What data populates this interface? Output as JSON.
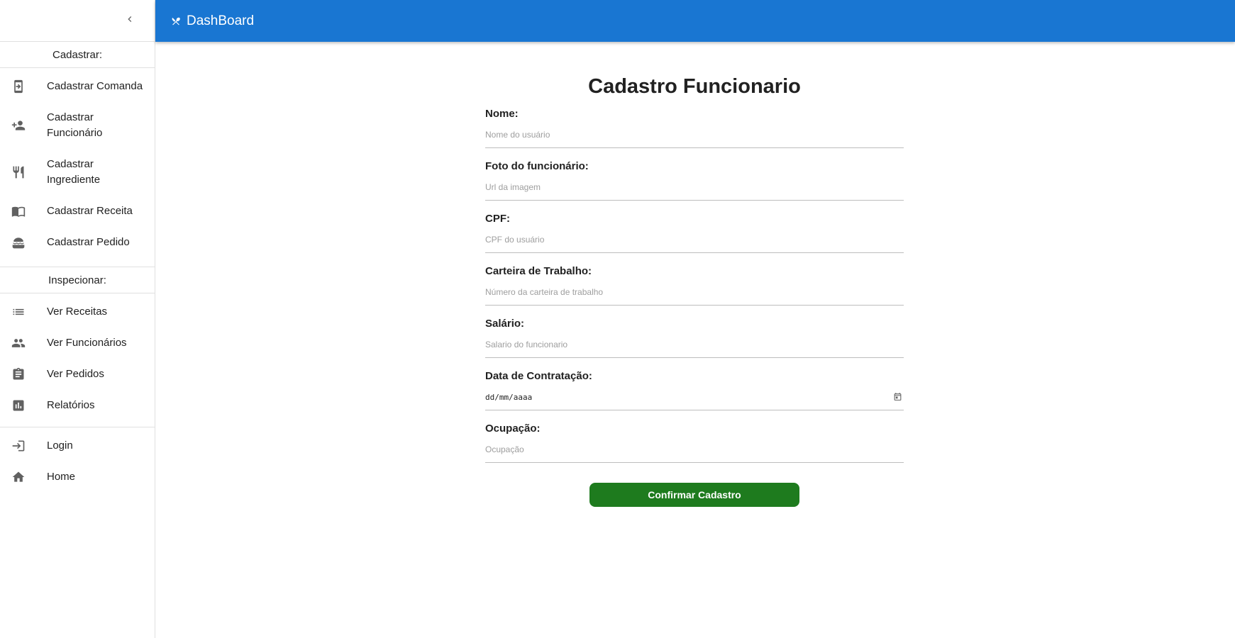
{
  "appbar": {
    "title": "DashBoard"
  },
  "sidebar": {
    "section_register": "Cadastrar:",
    "register_items": [
      {
        "label": "Cadastrar Comanda",
        "icon": "tablet-login-icon"
      },
      {
        "label": "Cadastrar Funcionário",
        "icon": "person-add-icon"
      },
      {
        "label": "Cadastrar Ingrediente",
        "icon": "restaurant-icon"
      },
      {
        "label": "Cadastrar Receita",
        "icon": "menu-book-icon"
      },
      {
        "label": "Cadastrar Pedido",
        "icon": "lunch-dining-icon"
      }
    ],
    "section_inspect": "Inspecionar:",
    "inspect_items": [
      {
        "label": "Ver Receitas",
        "icon": "list-icon"
      },
      {
        "label": "Ver Funcionários",
        "icon": "people-icon"
      },
      {
        "label": "Ver Pedidos",
        "icon": "assignment-icon"
      },
      {
        "label": "Relatórios",
        "icon": "bar-chart-icon"
      }
    ],
    "bottom_items": [
      {
        "label": "Login",
        "icon": "login-icon"
      },
      {
        "label": "Home",
        "icon": "home-icon"
      }
    ]
  },
  "form": {
    "title": "Cadastro Funcionario",
    "fields": [
      {
        "label": "Nome:",
        "placeholder": "Nome do usuário"
      },
      {
        "label": "Foto do funcionário:",
        "placeholder": "Url da imagem"
      },
      {
        "label": "CPF:",
        "placeholder": "CPF do usuário"
      },
      {
        "label": "Carteira de Trabalho:",
        "placeholder": "Número da carteira de trabalho"
      },
      {
        "label": "Salário:",
        "placeholder": "Salario do funcionario"
      },
      {
        "label": "Data de Contratação:",
        "placeholder": "dd/mm/aaaa"
      },
      {
        "label": "Ocupação:",
        "placeholder": "Ocupação"
      }
    ],
    "submit_label": "Confirmar Cadastro"
  },
  "colors": {
    "appbar": "#1976d2",
    "submit": "#1e7b1e"
  }
}
